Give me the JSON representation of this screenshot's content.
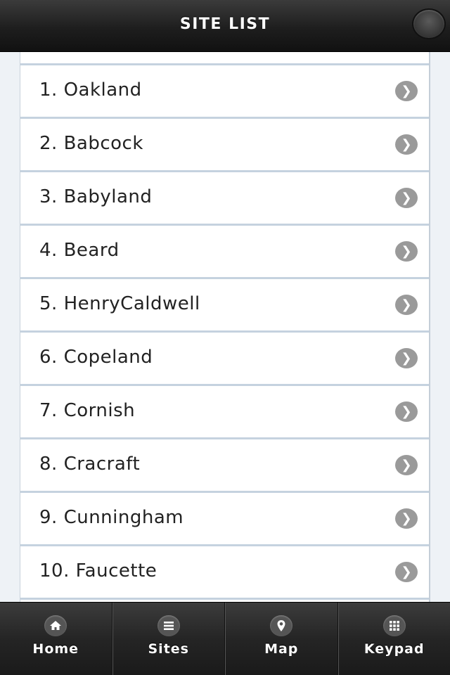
{
  "header": {
    "title": "SITE LIST"
  },
  "sites": [
    {
      "label": "1. Oakland",
      "icon": "chevron-right-icon"
    },
    {
      "label": "2. Babcock",
      "icon": "chevron-right-icon"
    },
    {
      "label": "3. Babyland",
      "icon": "chevron-right-icon"
    },
    {
      "label": "4. Beard",
      "icon": "chevron-right-icon"
    },
    {
      "label": "5. HenryCaldwell",
      "icon": "chevron-right-icon"
    },
    {
      "label": "6. Copeland",
      "icon": "chevron-right-icon"
    },
    {
      "label": "7. Cornish",
      "icon": "chevron-right-icon"
    },
    {
      "label": "8. Cracraft",
      "icon": "chevron-right-icon"
    },
    {
      "label": "9. Cunningham",
      "icon": "chevron-right-icon"
    },
    {
      "label": "10. Faucette",
      "icon": "chevron-right-icon"
    }
  ],
  "chevron_glyph": "❯",
  "nav": {
    "tabs": [
      {
        "label": "Home",
        "icon": "home-icon"
      },
      {
        "label": "Sites",
        "icon": "list-icon"
      },
      {
        "label": "Map",
        "icon": "map-pin-icon"
      },
      {
        "label": "Keypad",
        "icon": "keypad-icon"
      }
    ]
  },
  "colors": {
    "header_bg": "#1e1e1e",
    "list_divider": "#c5d2df",
    "chevron_bg": "#9a9a9a",
    "page_bg": "#eef2f6"
  }
}
